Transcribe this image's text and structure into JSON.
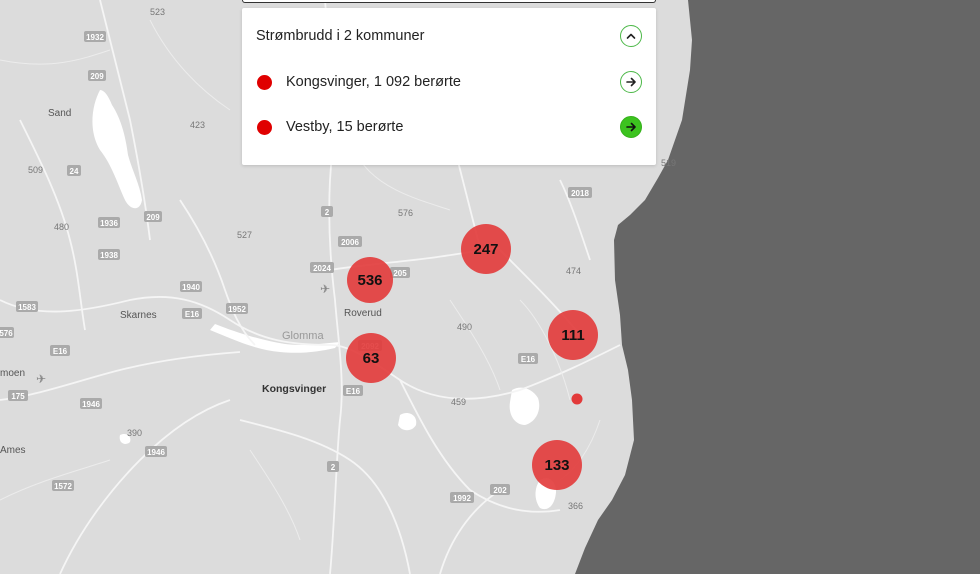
{
  "panel": {
    "title": "Strømbrudd i 2 kommuner",
    "collapse_icon": "chevron-up-icon",
    "items": [
      {
        "label": "Kongsvinger, 1 092 berørte",
        "icon": "arrow-right-icon",
        "style": "outline"
      },
      {
        "label": "Vestby, 15 berørte",
        "icon": "arrow-right-icon",
        "style": "filled"
      }
    ]
  },
  "clusters": [
    {
      "label": "536"
    },
    {
      "label": "63"
    },
    {
      "label": "247"
    },
    {
      "label": "111"
    },
    {
      "label": "133"
    }
  ],
  "place_names": {
    "sand": "Sand",
    "skarnes": "Skarnes",
    "roverud": "Roverud",
    "glomma": "Glomma",
    "kongsvinger": "Kongsvinger",
    "amoen": "moen",
    "ames": "Ames"
  },
  "road_numbers": {
    "r1932": "1932",
    "r209a": "209",
    "r24": "24",
    "r1936": "1936",
    "r209b": "209",
    "r1938": "1938",
    "r1583": "1583",
    "r576": "576",
    "r175": "175",
    "r1940": "1940",
    "r1952": "1952",
    "e16a": "E16",
    "e16b": "E16",
    "e16c": "E16",
    "e16d": "E16",
    "r2a": "2",
    "r2006": "2006",
    "r2024": "2024",
    "r205": "205",
    "r2092": "2092",
    "r1946a": "1946",
    "r1946b": "1946",
    "r1572": "1572",
    "r2b": "2",
    "r1992": "1992",
    "r202": "202",
    "r2018": "2018"
  },
  "map_numbers": {
    "n523": "523",
    "n423": "423",
    "n509": "509",
    "n480": "480",
    "n527": "527",
    "n576": "576",
    "n474": "474",
    "n490": "490",
    "n459": "459",
    "n390": "390",
    "n366": "366",
    "n519": "519"
  },
  "colors": {
    "land": "#dcdcdc",
    "sea": "#666666",
    "water": "#ffffff",
    "cluster": "#e23a3a",
    "accent_green": "#3cc31f",
    "outage_red": "#e00000"
  }
}
